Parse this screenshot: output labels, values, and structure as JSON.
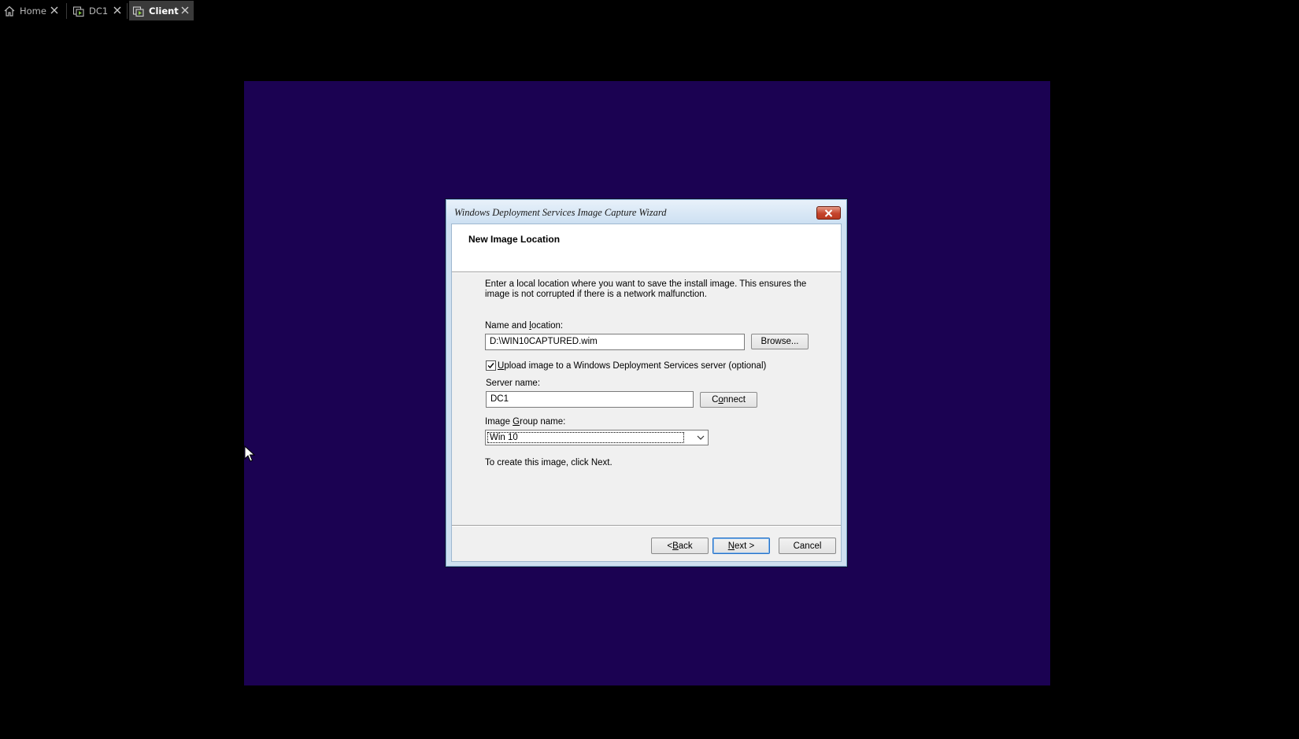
{
  "tabs": [
    {
      "label": "Home",
      "icon": "home-icon",
      "active": false
    },
    {
      "label": "DC1",
      "icon": "vm-icon",
      "active": false
    },
    {
      "label": "Client",
      "icon": "vm-running-icon",
      "active": true
    }
  ],
  "dialog": {
    "title": "Windows Deployment Services Image Capture Wizard",
    "header": "New Image Location",
    "description_line1": "Enter a local location where you want to save the install image. This ensures the",
    "description_line2": "image is not corrupted if there is a network malfunction.",
    "name_location_label_pre": "Name and ",
    "name_location_label_u": "l",
    "name_location_label_post": "ocation:",
    "name_location_value": "D:\\WIN10CAPTURED.wim",
    "browse_label": "Browse...",
    "upload_checked": true,
    "upload_label_u": "U",
    "upload_label_post": "pload image to a Windows Deployment Services server (optional)",
    "server_name_label": "Server name:",
    "server_name_value": "DC1",
    "connect_label_pre": "C",
    "connect_label_u": "o",
    "connect_label_post": "nnect",
    "image_group_label_pre": "Image ",
    "image_group_label_u": "G",
    "image_group_label_post": "roup name:",
    "image_group_value": "Win 10",
    "instruction": "To create this image, click Next.",
    "back_label_pre": "< ",
    "back_label_u": "B",
    "back_label_post": "ack",
    "next_label_u": "N",
    "next_label_post": "ext >",
    "cancel_label": "Cancel"
  },
  "colors": {
    "vm_background": "#1b0252",
    "host_background": "#000000",
    "dialog_frame": "#cfe0f0",
    "default_button_border": "#2672c8"
  }
}
